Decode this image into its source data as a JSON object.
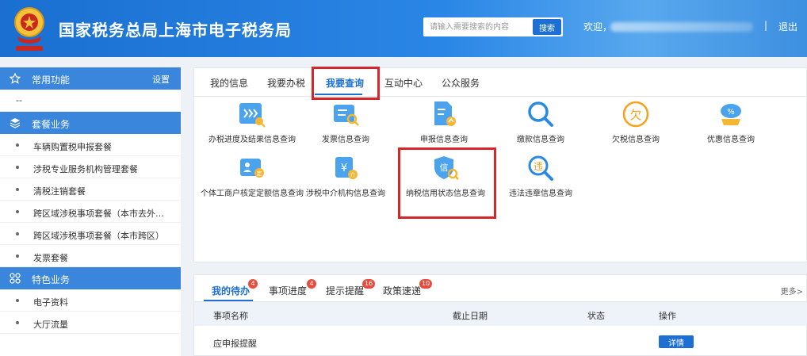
{
  "header": {
    "title": "国家税务总局上海市电子税务局",
    "search_placeholder": "请输入需要搜索的内容",
    "search_button": "搜索",
    "welcome": "欢迎，",
    "separator": "|",
    "logout": "退出"
  },
  "sidebar": {
    "common": {
      "label": "常用功能",
      "setting": "设置",
      "items": [
        "--"
      ]
    },
    "package": {
      "label": "套餐业务",
      "items": [
        "车辆购置税申报套餐",
        "涉税专业服务机构管理套餐",
        "清税注销套餐",
        "跨区域涉税事项套餐（本市去外…",
        "跨区域涉税事项套餐（本市跨区）",
        "发票套餐"
      ]
    },
    "feature": {
      "label": "特色业务",
      "items": [
        "电子资料",
        "大厅流量"
      ]
    }
  },
  "tabs": [
    {
      "label": "我的信息"
    },
    {
      "label": "我要办税"
    },
    {
      "label": "我要查询"
    },
    {
      "label": "互动中心"
    },
    {
      "label": "公众服务"
    }
  ],
  "services": [
    {
      "name": "办税进度及结果信息查询",
      "icon": "progress-icon"
    },
    {
      "name": "发票信息查询",
      "icon": "invoice-icon"
    },
    {
      "name": "申报信息查询",
      "icon": "declaration-icon"
    },
    {
      "name": "缴款信息查询",
      "icon": "payment-search-icon"
    },
    {
      "name": "欠税信息查询",
      "icon": "arrears-icon"
    },
    {
      "name": "优惠信息查询",
      "icon": "discount-icon"
    },
    {
      "name": "个体工商户核定定额信息查询",
      "icon": "individual-business-icon"
    },
    {
      "name": "涉税中介机构信息查询",
      "icon": "agency-icon"
    },
    {
      "name": "纳税信用状态信息查询",
      "icon": "credit-icon"
    },
    {
      "name": "违法违章信息查询",
      "icon": "violation-icon"
    }
  ],
  "bottom": {
    "tabs": [
      {
        "label": "我的待办",
        "badge": "4"
      },
      {
        "label": "事项进度",
        "badge": "4"
      },
      {
        "label": "提示提醒",
        "badge": "16"
      },
      {
        "label": "政策速递",
        "badge": "10"
      }
    ],
    "more": "更多>",
    "columns": [
      "事项名称",
      "截止日期",
      "状态",
      "操作"
    ],
    "rows": [
      {
        "name": "应申报提醒",
        "date": "",
        "status": "",
        "action": "详情"
      }
    ]
  },
  "colors": {
    "primary": "#1d6fd4",
    "header": "#2a86e6",
    "highlight": "#d7262a",
    "badge": "#e74c3c"
  }
}
